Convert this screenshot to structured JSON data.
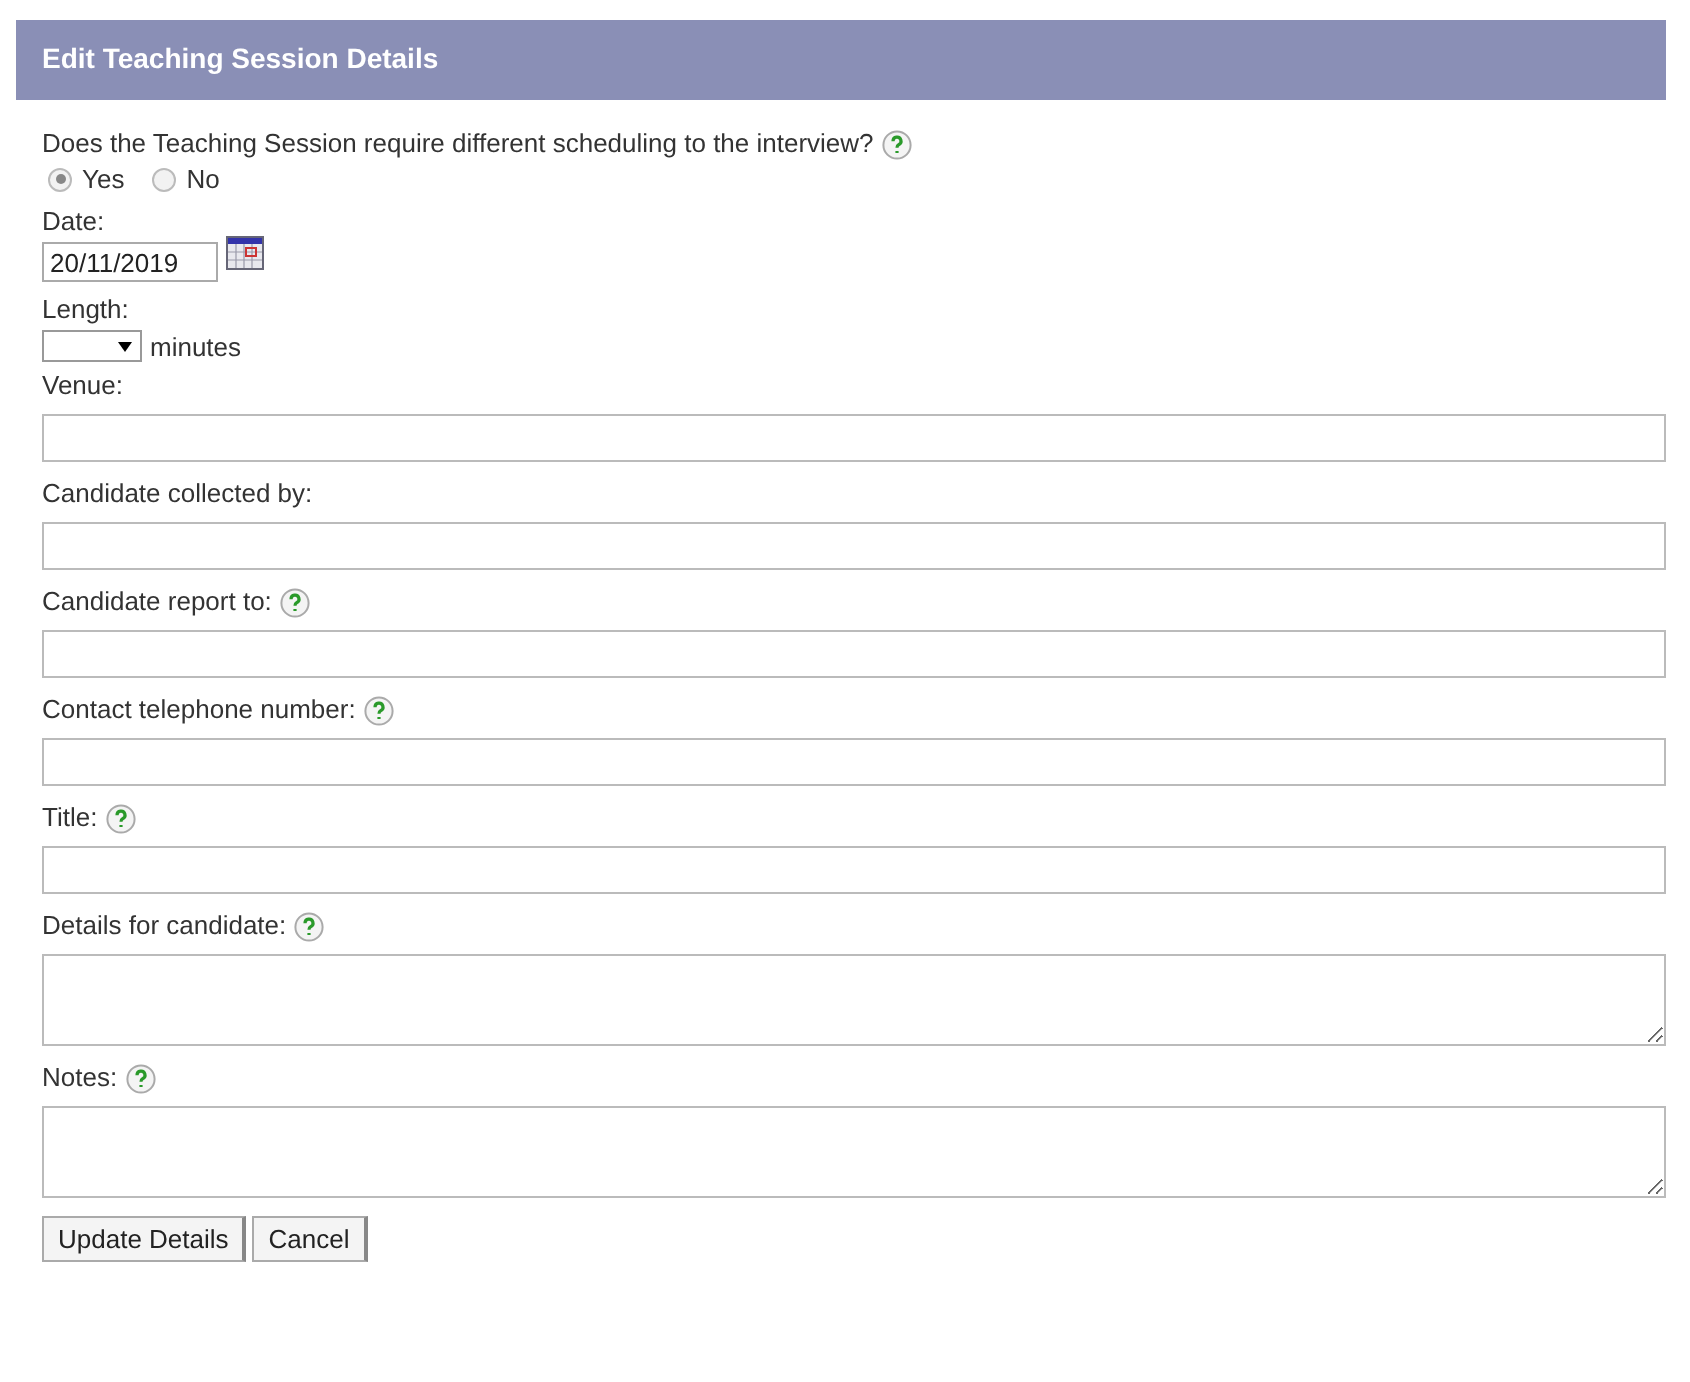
{
  "header": {
    "title": "Edit Teaching Session Details"
  },
  "question": {
    "label": "Does the Teaching Session require different scheduling to the interview?",
    "help": true,
    "options": [
      {
        "label": "Yes",
        "selected": true
      },
      {
        "label": "No",
        "selected": false
      }
    ]
  },
  "date": {
    "label": "Date:",
    "value": "20/11/2019"
  },
  "length": {
    "label": "Length:",
    "unit": "minutes"
  },
  "fields": [
    {
      "label": "Venue:",
      "help": false,
      "kind": "text"
    },
    {
      "label": "Candidate collected by:",
      "help": false,
      "kind": "text"
    },
    {
      "label": "Candidate report to:",
      "help": true,
      "kind": "text"
    },
    {
      "label": "Contact telephone number:",
      "help": true,
      "kind": "text"
    },
    {
      "label": "Title:",
      "help": true,
      "kind": "text"
    },
    {
      "label": "Details for candidate:",
      "help": true,
      "kind": "textarea"
    },
    {
      "label": "Notes:",
      "help": true,
      "kind": "textarea"
    }
  ],
  "buttons": [
    "Update Details",
    "Cancel"
  ]
}
